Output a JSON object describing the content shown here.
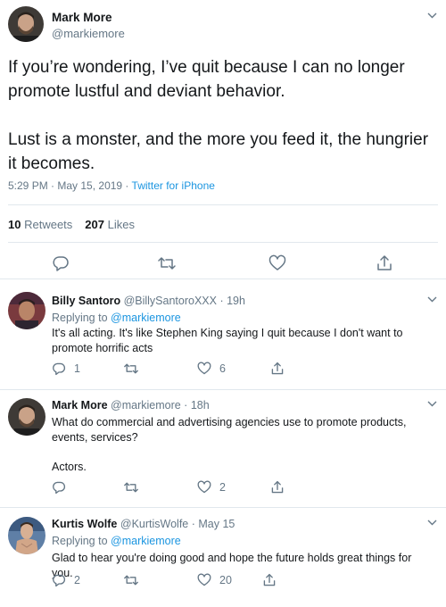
{
  "tweet": {
    "name": "Mark More",
    "handle": "@markiemore",
    "text_p1": "If you’re wondering, I’ve quit because I can no longer promote lustful and deviant behavior.",
    "text_p2": "Lust is a monster, and the more you feed it, the hungrier it becomes.",
    "time": "5:29 PM",
    "date": "May 15, 2019",
    "via": "Twitter for iPhone",
    "retweets_count": "10",
    "retweets_label": "Retweets",
    "likes_count": "207",
    "likes_label": "Likes"
  },
  "replies": [
    {
      "name": "Billy Santoro",
      "handle": "@BillySantoroXXX",
      "age": "19h",
      "replying_prefix": "Replying to",
      "replying_to": "@markiemore",
      "text": "It's all acting.  It's like Stephen King saying I quit because I don't want to promote horrific acts",
      "reply_count": "1",
      "retweet_count": "",
      "like_count": "6"
    },
    {
      "name": "Mark More",
      "handle": "@markiemore",
      "age": "18h",
      "text": "What do commercial and advertising agencies use to promote products, events, services?",
      "text2": "Actors.",
      "reply_count": "",
      "retweet_count": "",
      "like_count": "2"
    },
    {
      "name": "Kurtis Wolfe",
      "handle": "@KurtisWolfe",
      "age": "May 15",
      "replying_prefix": "Replying to",
      "replying_to": "@markiemore",
      "text": "Glad to hear you're doing good and hope the future holds great things for you.",
      "reply_count": "2",
      "retweet_count": "",
      "like_count": "20"
    }
  ],
  "icons": {
    "reply": "reply-icon",
    "retweet": "retweet-icon",
    "like": "heart-icon",
    "share": "share-icon",
    "more": "chevron-down-icon"
  },
  "colors": {
    "text": "#14171a",
    "muted": "#657786",
    "link": "#1b95e0",
    "divider": "#e1e8ed"
  }
}
